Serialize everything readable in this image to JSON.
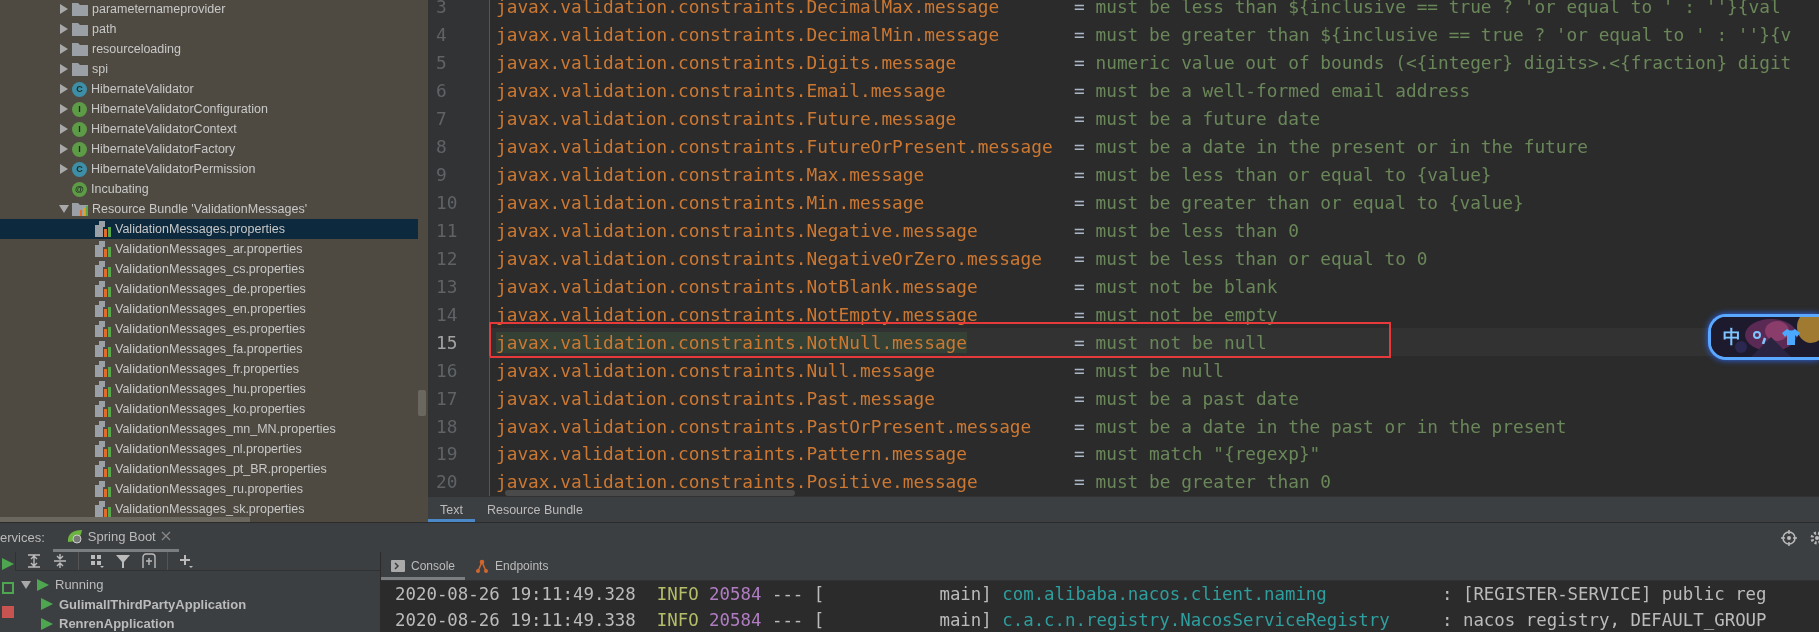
{
  "project_tree": {
    "items": [
      {
        "kind": "folder",
        "label": "parameternameprovider",
        "expanded": false
      },
      {
        "kind": "folder",
        "label": "path",
        "expanded": false
      },
      {
        "kind": "folder",
        "label": "resourceloading",
        "expanded": false
      },
      {
        "kind": "folder",
        "label": "spi",
        "expanded": false
      },
      {
        "kind": "class",
        "icon_letter": "C",
        "label": "HibernateValidator",
        "expanded": false
      },
      {
        "kind": "interface",
        "icon_letter": "I",
        "label": "HibernateValidatorConfiguration",
        "expanded": false
      },
      {
        "kind": "interface",
        "icon_letter": "I",
        "label": "HibernateValidatorContext",
        "expanded": false
      },
      {
        "kind": "interface",
        "icon_letter": "I",
        "label": "HibernateValidatorFactory",
        "expanded": false
      },
      {
        "kind": "class",
        "icon_letter": "C",
        "label": "HibernateValidatorPermission",
        "expanded": false
      },
      {
        "kind": "annotation",
        "icon_letter": "@",
        "label": "Incubating"
      },
      {
        "kind": "bundle",
        "label": "Resource Bundle 'ValidationMessages'",
        "expanded": true,
        "children": [
          {
            "kind": "properties",
            "label": "ValidationMessages.properties",
            "selected": true
          },
          {
            "kind": "properties",
            "label": "ValidationMessages_ar.properties",
            "selected": false
          },
          {
            "kind": "properties",
            "label": "ValidationMessages_cs.properties",
            "selected": false
          },
          {
            "kind": "properties",
            "label": "ValidationMessages_de.properties",
            "selected": false
          },
          {
            "kind": "properties",
            "label": "ValidationMessages_en.properties",
            "selected": false
          },
          {
            "kind": "properties",
            "label": "ValidationMessages_es.properties",
            "selected": false
          },
          {
            "kind": "properties",
            "label": "ValidationMessages_fa.properties",
            "selected": false
          },
          {
            "kind": "properties",
            "label": "ValidationMessages_fr.properties",
            "selected": false
          },
          {
            "kind": "properties",
            "label": "ValidationMessages_hu.properties",
            "selected": false
          },
          {
            "kind": "properties",
            "label": "ValidationMessages_ko.properties",
            "selected": false
          },
          {
            "kind": "properties",
            "label": "ValidationMessages_mn_MN.properties",
            "selected": false
          },
          {
            "kind": "properties",
            "label": "ValidationMessages_nl.properties",
            "selected": false
          },
          {
            "kind": "properties",
            "label": "ValidationMessages_pt_BR.properties",
            "selected": false
          },
          {
            "kind": "properties",
            "label": "ValidationMessages_ru.properties",
            "selected": false
          },
          {
            "kind": "properties",
            "label": "ValidationMessages_sk.properties",
            "selected": false
          }
        ]
      }
    ]
  },
  "editor": {
    "lines": [
      {
        "number": "3",
        "key": "javax.validation.constraints.DecimalMax.message",
        "separator": "=",
        "value": "must be less than ${inclusive == true ? 'or equal to ' : ''}{val",
        "current": false,
        "boxed": false
      },
      {
        "number": "4",
        "key": "javax.validation.constraints.DecimalMin.message",
        "separator": "=",
        "value": "must be greater than ${inclusive == true ? 'or equal to ' : ''}{v",
        "current": false,
        "boxed": false
      },
      {
        "number": "5",
        "key": "javax.validation.constraints.Digits.message",
        "separator": "=",
        "value": "numeric value out of bounds (<{integer} digits>.<{fraction} digit",
        "current": false,
        "boxed": false
      },
      {
        "number": "6",
        "key": "javax.validation.constraints.Email.message",
        "separator": "=",
        "value": "must be a well-formed email address",
        "current": false,
        "boxed": false
      },
      {
        "number": "7",
        "key": "javax.validation.constraints.Future.message",
        "separator": "=",
        "value": "must be a future date",
        "current": false,
        "boxed": false
      },
      {
        "number": "8",
        "key": "javax.validation.constraints.FutureOrPresent.message",
        "separator": "=",
        "value": "must be a date in the present or in the future",
        "current": false,
        "boxed": false
      },
      {
        "number": "9",
        "key": "javax.validation.constraints.Max.message",
        "separator": "=",
        "value": "must be less than or equal to {value}",
        "current": false,
        "boxed": false
      },
      {
        "number": "10",
        "key": "javax.validation.constraints.Min.message",
        "separator": "=",
        "value": "must be greater than or equal to {value}",
        "current": false,
        "boxed": false
      },
      {
        "number": "11",
        "key": "javax.validation.constraints.Negative.message",
        "separator": "=",
        "value": "must be less than 0",
        "current": false,
        "boxed": false
      },
      {
        "number": "12",
        "key": "javax.validation.constraints.NegativeOrZero.message",
        "separator": "=",
        "value": "must be less than or equal to 0",
        "current": false,
        "boxed": false
      },
      {
        "number": "13",
        "key": "javax.validation.constraints.NotBlank.message",
        "separator": "=",
        "value": "must not be blank",
        "current": false,
        "boxed": false
      },
      {
        "number": "14",
        "key": "javax.validation.constraints.NotEmpty.message",
        "separator": "=",
        "value": "must not be empty",
        "current": false,
        "boxed": false
      },
      {
        "number": "15",
        "key": "javax.validation.constraints.NotNull.message",
        "separator": "=",
        "value": "must not be null",
        "current": true,
        "boxed": true
      },
      {
        "number": "16",
        "key": "javax.validation.constraints.Null.message",
        "separator": "=",
        "value": "must be null",
        "current": false,
        "boxed": false
      },
      {
        "number": "17",
        "key": "javax.validation.constraints.Past.message",
        "separator": "=",
        "value": "must be a past date",
        "current": false,
        "boxed": false
      },
      {
        "number": "18",
        "key": "javax.validation.constraints.PastOrPresent.message",
        "separator": "=",
        "value": "must be a date in the past or in the present",
        "current": false,
        "boxed": false
      },
      {
        "number": "19",
        "key": "javax.validation.constraints.Pattern.message",
        "separator": "=",
        "value": "must match \"{regexp}\"",
        "current": false,
        "boxed": false
      },
      {
        "number": "20",
        "key": "javax.validation.constraints.Positive.message",
        "separator": "=",
        "value": "must be greater than 0",
        "current": false,
        "boxed": false
      }
    ],
    "tabs": [
      {
        "label": "Text",
        "selected": true
      },
      {
        "label": "Resource Bundle",
        "selected": false
      }
    ]
  },
  "services_bar": {
    "title": "ervices:",
    "tabs": [
      {
        "label": "Spring Boot",
        "selected": true
      }
    ]
  },
  "services_tree": [
    {
      "label": "Running",
      "expanded": true,
      "children": [
        {
          "label": "GulimallThirdPartyApplication"
        },
        {
          "label": "RenrenApplication"
        }
      ]
    }
  ],
  "console": {
    "tabs": [
      {
        "label": "Console",
        "selected": true
      },
      {
        "label": "Endpoints",
        "selected": false
      }
    ],
    "lines": [
      {
        "timestamp": "2020-08-26 19:11:49.328",
        "level": "INFO",
        "pid": "20584",
        "thread": "--- [           main]",
        "logger": "com.alibaba.nacos.client.naming",
        "message": ": [REGISTER-SERVICE] public reg"
      },
      {
        "timestamp": "2020-08-26 19:11:49.338",
        "level": "INFO",
        "pid": "20584",
        "thread": "--- [           main]",
        "logger": "c.a.c.n.registry.NacosServiceRegistry",
        "message": ": nacos registry, DEFAULT_GROUP"
      }
    ]
  },
  "ime_toolbar": {
    "mode": "中"
  }
}
